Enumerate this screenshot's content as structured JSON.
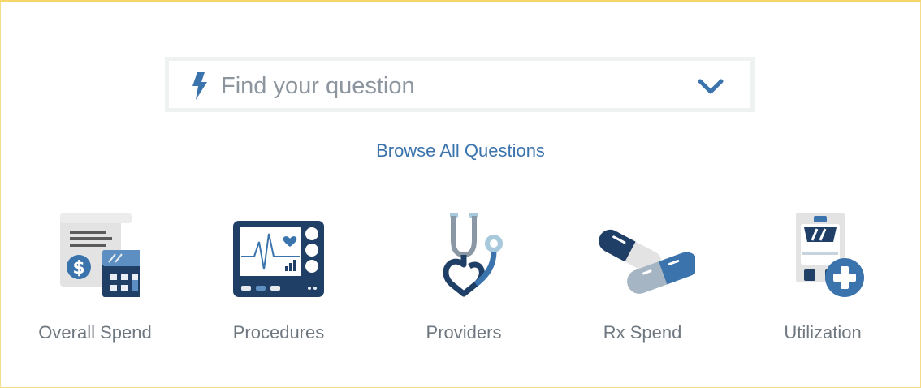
{
  "search": {
    "placeholder": "Find your question",
    "value": "",
    "lead_icon": "lightning-bolt-icon",
    "trail_icon": "chevron-down-icon"
  },
  "browse_link": "Browse All Questions",
  "categories": [
    {
      "label": "Overall Spend",
      "icon": "invoice-calculator-icon"
    },
    {
      "label": "Procedures",
      "icon": "heart-monitor-icon"
    },
    {
      "label": "Providers",
      "icon": "stethoscope-icon"
    },
    {
      "label": "Rx Spend",
      "icon": "pills-icon"
    },
    {
      "label": "Utilization",
      "icon": "ambulance-icon"
    }
  ],
  "colors": {
    "accent": "#3b73ad",
    "navy": "#1f3f66",
    "border": "#f7d56b",
    "search_border": "#eef3f1",
    "label": "#6f7880"
  }
}
